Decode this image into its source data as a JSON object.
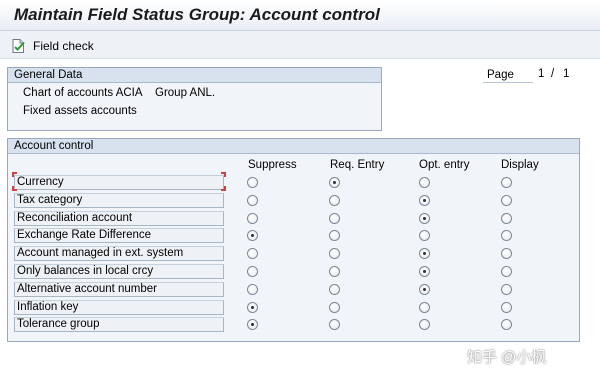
{
  "window": {
    "title": "Maintain Field Status Group: Account control"
  },
  "toolbar": {
    "field_check_label": "Field check",
    "field_check_icon": "field-check-icon"
  },
  "general_data": {
    "header": "General Data",
    "line1": "Chart of accounts ACIA",
    "group": "Group ANL.",
    "line2": "Fixed assets accounts"
  },
  "paging": {
    "label": "Page",
    "current": "1",
    "separator": "/",
    "total": "1"
  },
  "account_control": {
    "header": "Account control",
    "columns": [
      "Suppress",
      "Req. Entry",
      "Opt. entry",
      "Display"
    ],
    "rows": [
      {
        "label": "Currency",
        "selected": 1
      },
      {
        "label": "Tax category",
        "selected": 2
      },
      {
        "label": "Reconciliation account",
        "selected": 2
      },
      {
        "label": "Exchange Rate Difference",
        "selected": 0
      },
      {
        "label": "Account managed in ext. system",
        "selected": 2
      },
      {
        "label": "Only balances in local crcy",
        "selected": 2
      },
      {
        "label": "Alternative account number",
        "selected": 2
      },
      {
        "label": "Inflation key",
        "selected": 0
      },
      {
        "label": "Tolerance group",
        "selected": 0
      }
    ]
  },
  "watermark": "知乎 @小枫",
  "colors": {
    "header_bg": "#d8e2ee",
    "panel_bg": "#f1f4f8",
    "focus": "#d04040"
  }
}
